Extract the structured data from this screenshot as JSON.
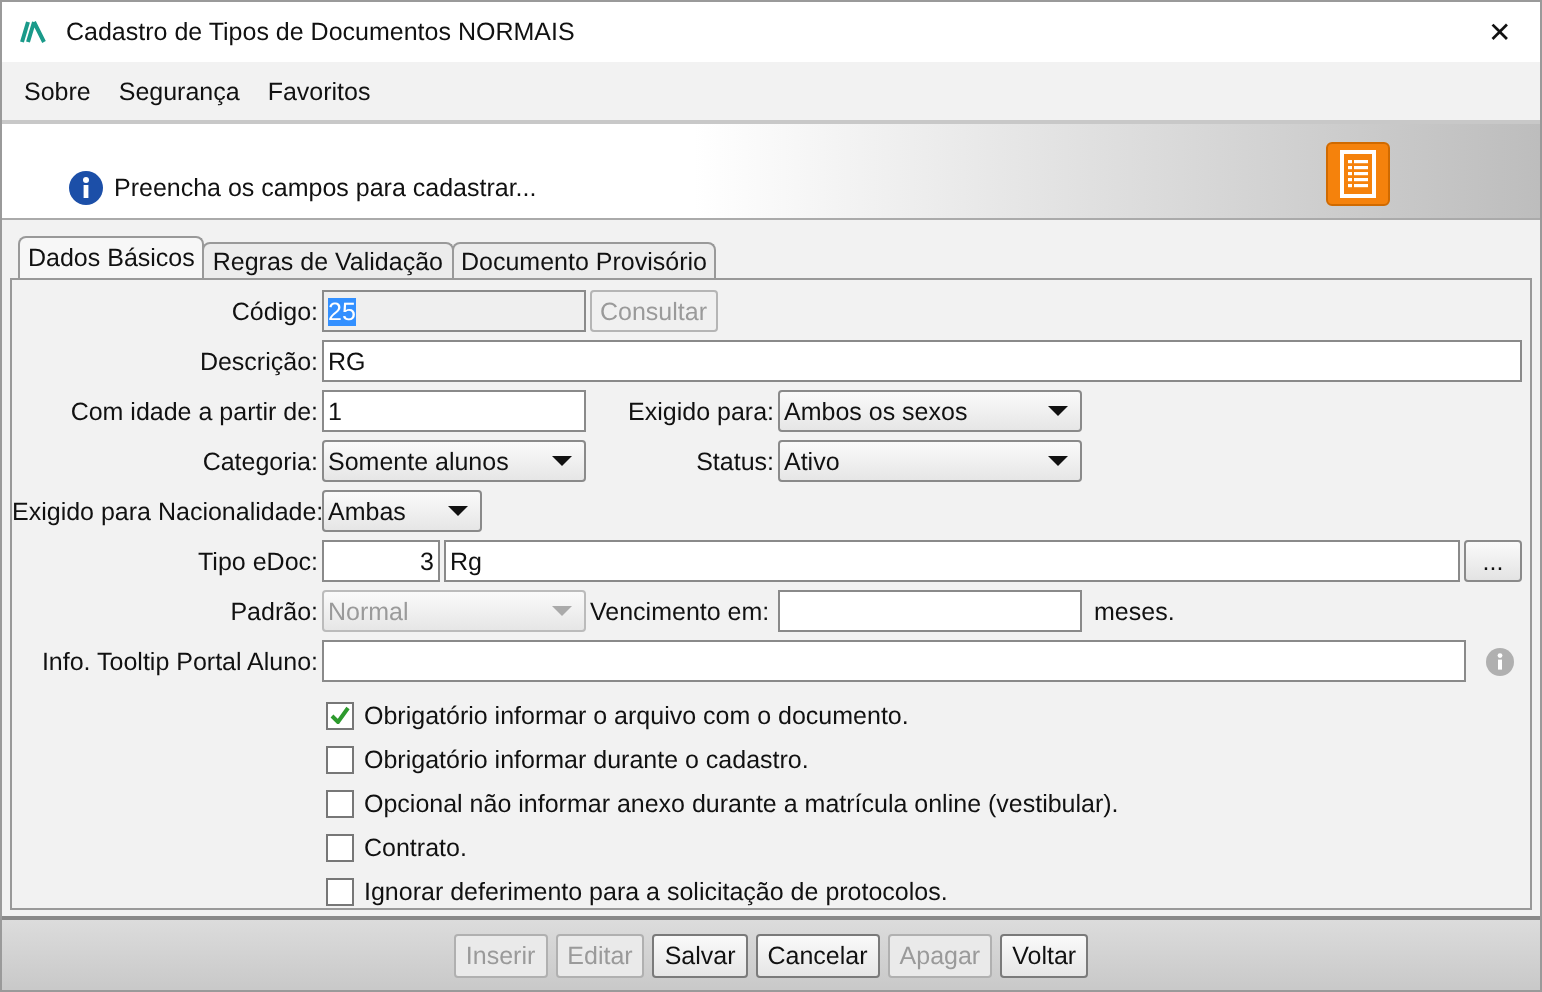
{
  "window": {
    "title": "Cadastro de Tipos de Documentos NORMAIS",
    "close": "✕"
  },
  "menu": [
    "Sobre",
    "Segurança",
    "Favoritos"
  ],
  "header": {
    "message": "Preencha os campos para cadastrar..."
  },
  "tabs": [
    {
      "label": "Dados Básicos",
      "selected": true
    },
    {
      "label": "Regras de Validação",
      "selected": false
    },
    {
      "label": "Documento Provisório",
      "selected": false
    }
  ],
  "form": {
    "codigo": {
      "label": "Código:",
      "value": "25",
      "highlighted": true,
      "button": "Consultar",
      "button_disabled": true
    },
    "descricao": {
      "label": "Descrição:",
      "value": "RG"
    },
    "idade": {
      "label": "Com idade a partir de:",
      "value": "1"
    },
    "exigido_para": {
      "label": "Exigido para:",
      "value": "Ambos os sexos"
    },
    "categoria": {
      "label": "Categoria:",
      "value": "Somente alunos"
    },
    "status": {
      "label": "Status:",
      "value": "Ativo"
    },
    "nacionalidade": {
      "label": "Exigido para Nacionalidade:",
      "value": "Ambas"
    },
    "tipo_edoc": {
      "label": "Tipo eDoc:",
      "code": "3",
      "value": "Rg",
      "button": "..."
    },
    "padrao": {
      "label": "Padrão:",
      "value": "Normal",
      "disabled": true
    },
    "vencimento": {
      "label": "Vencimento em:",
      "suffix": "meses."
    },
    "tooltip": {
      "label": "Info. Tooltip Portal Aluno:"
    }
  },
  "options": [
    {
      "label": "Obrigatório informar o arquivo com o documento.",
      "checked": true
    },
    {
      "label": "Obrigatório informar durante o cadastro.",
      "checked": false
    },
    {
      "label": "Opcional não informar anexo durante a matrícula online (vestibular).",
      "checked": false
    },
    {
      "label": "Contrato.",
      "checked": false
    },
    {
      "label": "Ignorar deferimento para a solicitação de protocolos.",
      "checked": false
    }
  ],
  "buttons": [
    {
      "label": "Inserir",
      "disabled": true
    },
    {
      "label": "Editar",
      "disabled": true
    },
    {
      "label": "Salvar",
      "disabled": false
    },
    {
      "label": "Cancelar",
      "disabled": false
    },
    {
      "label": "Apagar",
      "disabled": true
    },
    {
      "label": "Voltar",
      "disabled": false
    }
  ]
}
